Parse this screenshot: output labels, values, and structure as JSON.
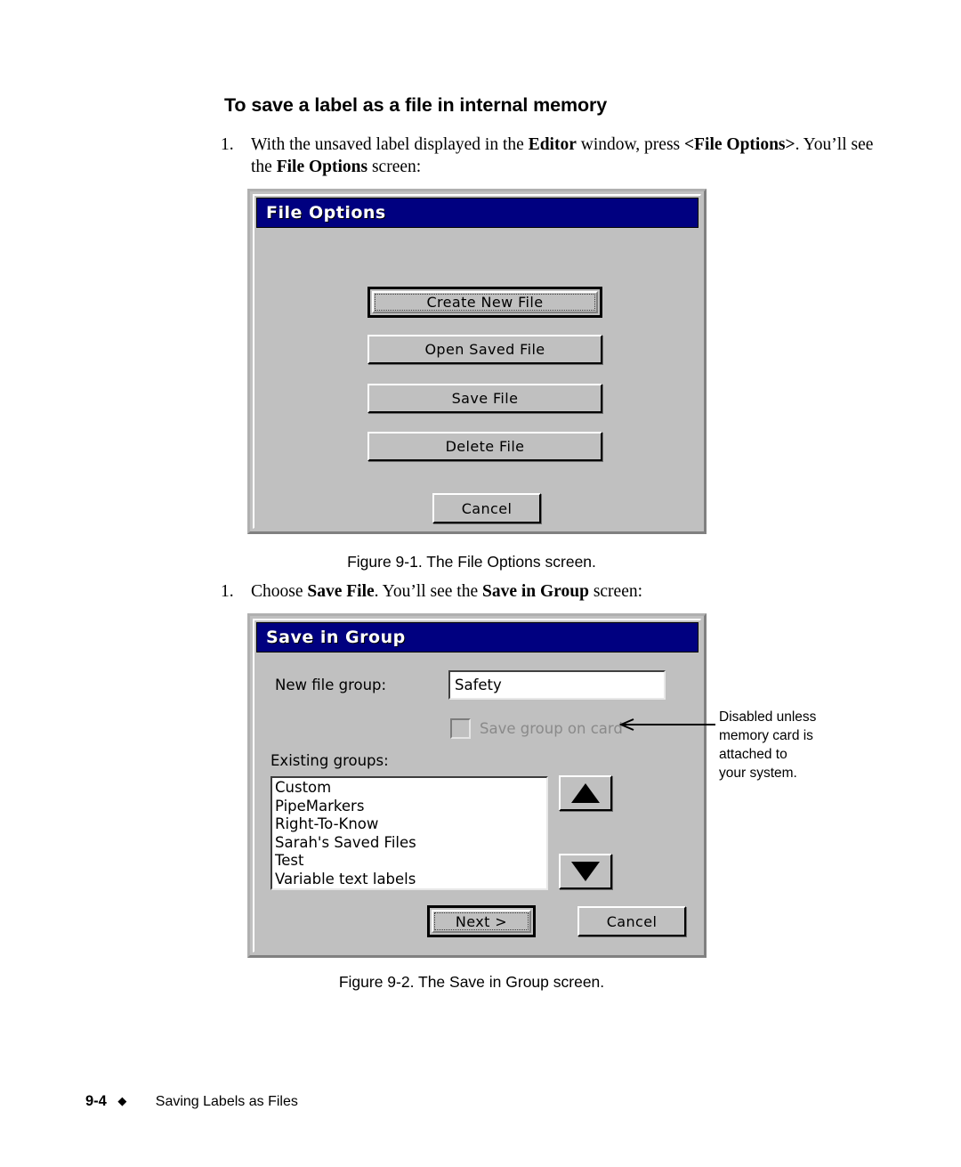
{
  "document": {
    "heading": "To save a label as a file in internal memory",
    "steps": [
      {
        "number": "1.",
        "segments": [
          {
            "t": "With the unsaved label displayed in the ",
            "b": false
          },
          {
            "t": "Editor",
            "b": true
          },
          {
            "t": " window, press ",
            "b": false
          },
          {
            "t": "<File Options>",
            "b": true
          },
          {
            "t": ". You’ll see the ",
            "b": false
          },
          {
            "t": "File Options",
            "b": true
          },
          {
            "t": " screen:",
            "b": false
          }
        ]
      },
      {
        "number": "1.",
        "segments": [
          {
            "t": "Choose ",
            "b": false
          },
          {
            "t": "Save File",
            "b": true
          },
          {
            "t": ". You’ll see the ",
            "b": false
          },
          {
            "t": "Save in Group",
            "b": true
          },
          {
            "t": " screen:",
            "b": false
          }
        ]
      }
    ],
    "captions": {
      "figure_1": "Figure 9-1. The File Options screen.",
      "figure_2": "Figure 9-2. The Save in Group screen."
    },
    "footer": {
      "page": "9-4",
      "diamond": "◆",
      "title": "Saving Labels as Files"
    }
  },
  "file_options_dialog": {
    "title": "File Options",
    "buttons": [
      {
        "label": "Create New File",
        "focused": true
      },
      {
        "label": "Open Saved File",
        "focused": false
      },
      {
        "label": "Save File",
        "focused": false
      },
      {
        "label": "Delete File",
        "focused": false
      }
    ],
    "cancel_label": "Cancel"
  },
  "save_in_group_dialog": {
    "title": "Save in Group",
    "new_file_group_label": "New file group:",
    "new_file_group_value": "Safety",
    "save_group_on_card_label": "Save group on card",
    "save_group_on_card_checked": false,
    "save_group_on_card_disabled": true,
    "existing_groups_label": "Existing groups:",
    "existing_groups": [
      "Custom",
      "PipeMarkers",
      "Right-To-Know",
      "Sarah's Saved Files",
      "Test",
      "Variable text labels"
    ],
    "scroll_up_icon": "triangle-up-icon",
    "scroll_down_icon": "triangle-down-icon",
    "next_label": "Next >",
    "cancel_label": "Cancel"
  },
  "annotation": {
    "lines": [
      "Disabled unless",
      "memory card is",
      "attached to",
      "your system."
    ],
    "arrow_icon": "left-arrow-icon"
  },
  "colors": {
    "titlebar": "#000080",
    "dialog_face": "#c0c0c0",
    "disabled_text": "#8a8a8a"
  }
}
